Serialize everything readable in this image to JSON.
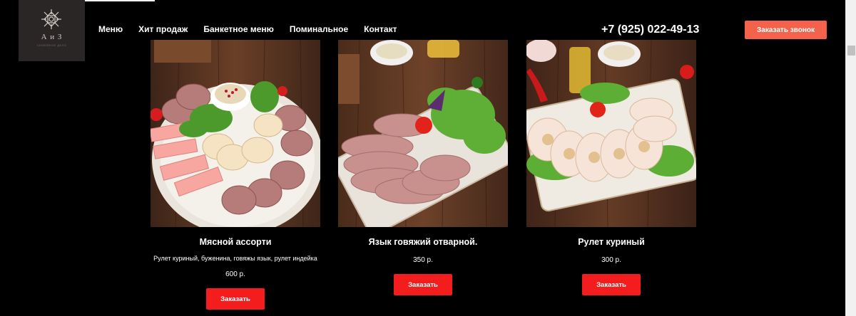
{
  "header": {
    "logo_text": "А и З",
    "logo_sub": "СЕМЕЙНОЕ ДЕЛО",
    "nav": [
      "Меню",
      "Хит продаж",
      "Банкетное меню",
      "Поминальное",
      "Контакт"
    ],
    "phone": "+7 (925) 022-49-13",
    "callback_label": "Заказать звонок"
  },
  "products": [
    {
      "title": "Мясной ассорти",
      "description": "Рулет куриный, буженина, говяжы язык, рулет индейка",
      "price": "600 р.",
      "button": "Заказать"
    },
    {
      "title": "Язык говяжий отварной.",
      "price": "350 р.",
      "button": "Заказать"
    },
    {
      "title": "Рулет куриный",
      "price": "300 р.",
      "button": "Заказать"
    }
  ],
  "colors": {
    "background": "#000000",
    "accent_callback": "#f4624b",
    "accent_order": "#f41d1d",
    "wood": "#5a3520"
  }
}
